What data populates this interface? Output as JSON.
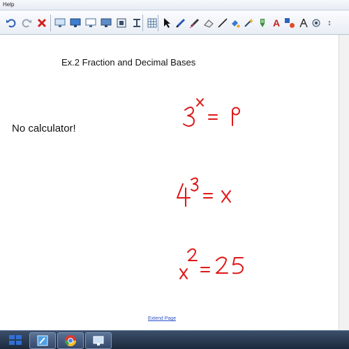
{
  "menu": {
    "help_label": "Help"
  },
  "toolbar": {
    "icons": [
      "undo-icon",
      "redo-icon",
      "delete-icon",
      "screen-shade-icon",
      "full-screen-icon",
      "monitor-icon",
      "screen-capture-icon",
      "capture-icon",
      "tape-icon",
      "table-icon",
      "select-icon",
      "pen-icon",
      "creative-pen-icon",
      "eraser-icon",
      "line-icon",
      "fill-icon",
      "magic-pen-icon",
      "highlighter-icon",
      "text-icon",
      "shapes-icon",
      "measurement-icon",
      "properties-icon",
      "more-icon"
    ],
    "text_tool_glyph": "A",
    "more_glyph": "↕"
  },
  "content": {
    "title": "Ex.2 Fraction and Decimal Bases",
    "note": "No calculator!",
    "extend_link": "Extend Page"
  },
  "handwriting": {
    "color": "#e01818",
    "equations": [
      {
        "text": "3^x = 9"
      },
      {
        "text": "4^3 = x"
      },
      {
        "text": "x^2 = 25"
      }
    ]
  },
  "taskbar": {
    "apps": [
      "start-icon",
      "notebook-app-icon",
      "chrome-app-icon",
      "smart-app-icon"
    ]
  }
}
